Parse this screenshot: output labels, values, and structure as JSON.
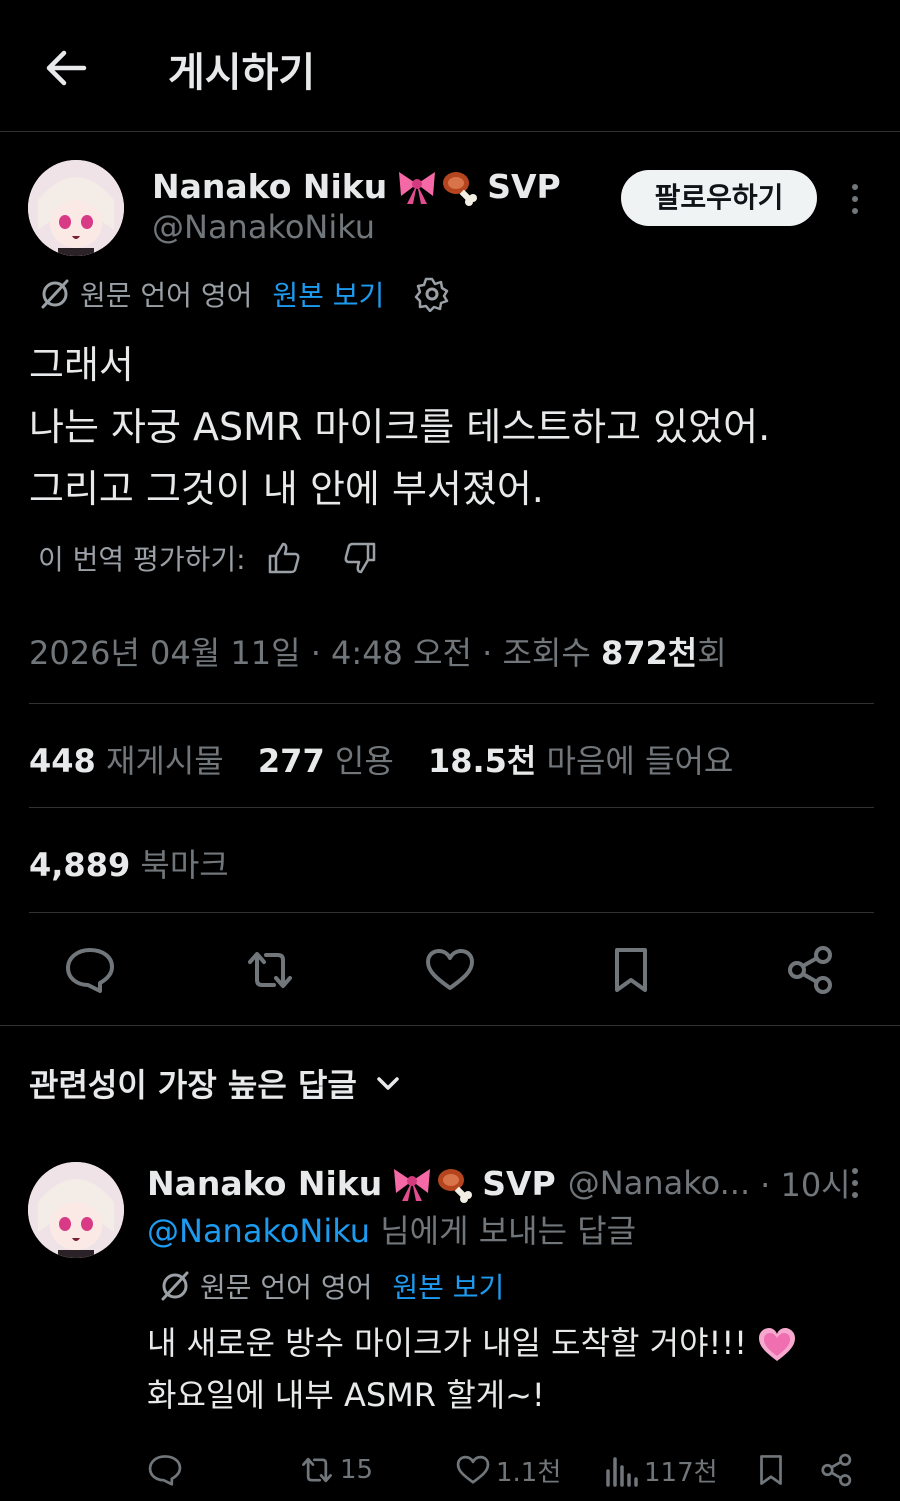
{
  "header": {
    "title": "게시하기"
  },
  "post": {
    "author_name": "Nanako Niku",
    "author_badge": "SVP",
    "handle": "@NanakoNiku",
    "follow_label": "팔로우하기",
    "translate_notice": "원문 언어 영어",
    "view_original": "원본 보기",
    "lines": [
      "그래서",
      "나는 자궁 ASMR 마이크를 테스트하고 있었어.",
      "그리고 그것이 내 안에 부서졌어."
    ],
    "rate_label": "이 번역 평가하기:",
    "timestamp": "2026년 04월 11일 · 4:48 오전 · 조회수 ",
    "views": "872천",
    "views_suffix": "회",
    "reposts_count": "448",
    "reposts_label": "재게시물",
    "quotes_count": "277",
    "quotes_label": "인용",
    "likes_count": "18.5천",
    "likes_label": "마음에 들어요",
    "bookmarks_count": "4,889",
    "bookmarks_label": "북마크"
  },
  "replies_sort": "관련성이 가장 높은 답글",
  "reply": {
    "author_name": "Nanako Niku",
    "author_badge": "SVP",
    "handle": "@Nanako...",
    "time": "· 10시",
    "reply_to_mention": "@NanakoNiku",
    "reply_to_suffix": " 님에게 보내는 답글",
    "translate_notice": "원문 언어 영어",
    "view_original": "원본 보기",
    "lines": [
      "내 새로운 방수 마이크가 내일 도착할 거야!!!",
      "화요일에 내부 ASMR 할게~!"
    ],
    "reposts": "15",
    "likes": "1.1천",
    "views": "117천"
  },
  "colors": {
    "accent": "#1d9bf0",
    "muted": "#71767b",
    "text": "#e7e9ea",
    "background": "#000000"
  }
}
